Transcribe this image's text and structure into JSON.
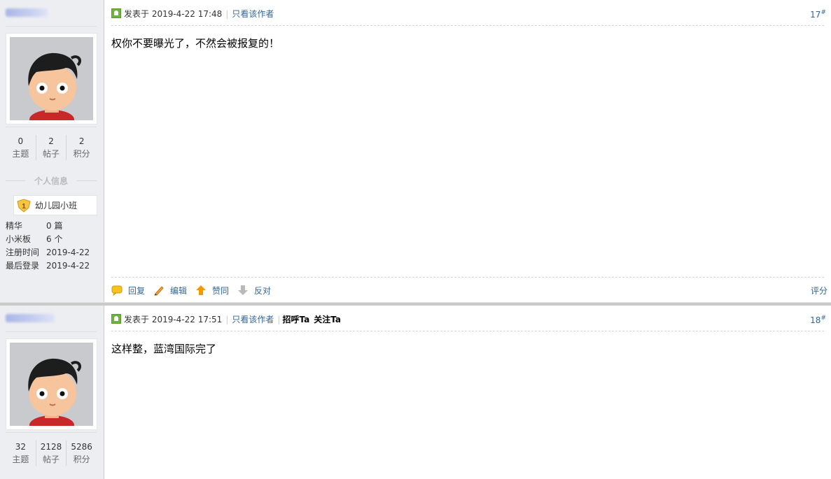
{
  "posts": [
    {
      "stats": [
        {
          "num": "0",
          "label": "主题"
        },
        {
          "num": "2",
          "label": "帖子"
        },
        {
          "num": "2",
          "label": "积分"
        }
      ],
      "info_title": "个人信息",
      "level": {
        "icon": "level-1-badge-icon",
        "text": "幼儿园小班"
      },
      "profile": [
        {
          "k": "精华",
          "v": "0 篇"
        },
        {
          "k": "小米板",
          "v": "6 个"
        },
        {
          "k": "注册时间",
          "v": "2019-4-22"
        },
        {
          "k": "最后登录",
          "v": "2019-4-22"
        }
      ],
      "posted": "发表于 2019-4-22 17:48",
      "only_author": "只看该作者",
      "floor": "17",
      "floor_sup": "#",
      "content": "权你不要曝光了，不然会被报复的！",
      "footer": {
        "reply": "回复",
        "edit": "编辑",
        "up": "赞同",
        "down": "反对",
        "score": "评分"
      }
    },
    {
      "stats": [
        {
          "num": "32",
          "label": "主题"
        },
        {
          "num": "2128",
          "label": "帖子"
        },
        {
          "num": "5286",
          "label": "积分"
        }
      ],
      "posted": "发表于 2019-4-22 17:51",
      "only_author": "只看该作者",
      "greet": "招呼Ta",
      "follow": "关注Ta",
      "floor": "18",
      "floor_sup": "#",
      "content": "这样整，蓝湾国际完了"
    }
  ],
  "colors": {
    "link": "#336699",
    "sidebar_bg": "#eceef1",
    "accent_orange": "#f39800"
  }
}
